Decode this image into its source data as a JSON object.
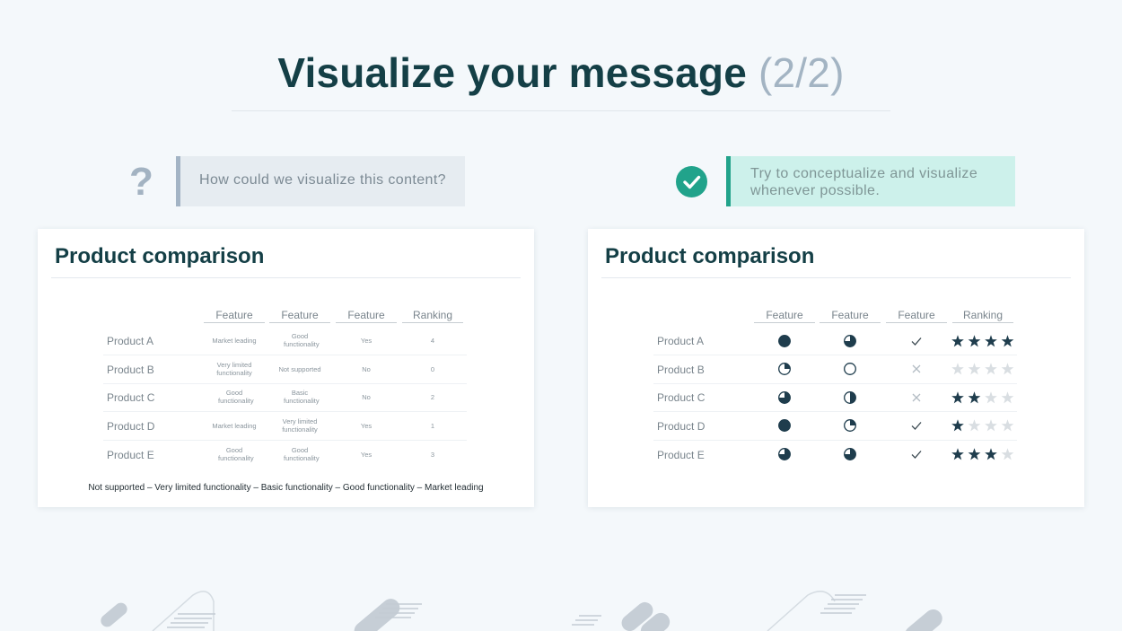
{
  "title": {
    "main": "Visualize your message",
    "accent": "(2/2)"
  },
  "left_prompt": {
    "mark": "?",
    "text": "How could  we visualize this content?"
  },
  "right_prompt": {
    "text_line1": "Try to conceptualize and visualize",
    "text_line2": "whenever possible."
  },
  "colors": {
    "dark": "#143f46",
    "accent_teal": "#22a38b",
    "muted": "#a3b4c3",
    "star_on": "#1f3d4d",
    "star_off": "#d9dee2"
  },
  "left_card": {
    "title": "Product comparison",
    "headers": [
      "Feature",
      "Feature",
      "Feature",
      "Ranking"
    ],
    "rows": [
      {
        "name": "Product A",
        "c1": "Market leading",
        "c2": "Good functionality",
        "c3": "Yes",
        "c4": "4"
      },
      {
        "name": "Product B",
        "c1": "Very limited functionality",
        "c2": "Not supported",
        "c3": "No",
        "c4": "0"
      },
      {
        "name": "Product C",
        "c1": "Good functionality",
        "c2": "Basic functionality",
        "c3": "No",
        "c4": "2"
      },
      {
        "name": "Product D",
        "c1": "Market leading",
        "c2": "Very limited functionality",
        "c3": "Yes",
        "c4": "1"
      },
      {
        "name": "Product E",
        "c1": "Good functionality",
        "c2": "Good functionality",
        "c3": "Yes",
        "c4": "3"
      }
    ],
    "legend": "Not supported – Very limited functionality – Basic functionality – Good functionality – Market leading"
  },
  "right_card": {
    "title": "Product comparison",
    "headers": [
      "Feature",
      "Feature",
      "Feature",
      "Ranking"
    ],
    "rows": [
      {
        "name": "Product A",
        "f1_level": 4,
        "f2_level": 3,
        "f3": "check-icon",
        "stars": 4
      },
      {
        "name": "Product B",
        "f1_level": 1,
        "f2_level": 0,
        "f3": "cross-icon",
        "stars": 0
      },
      {
        "name": "Product C",
        "f1_level": 3,
        "f2_level": 2,
        "f3": "cross-icon",
        "stars": 2
      },
      {
        "name": "Product D",
        "f1_level": 4,
        "f2_level": 1,
        "f3": "check-icon",
        "stars": 1
      },
      {
        "name": "Product E",
        "f1_level": 3,
        "f2_level": 3,
        "f3": "check-icon",
        "stars": 3
      }
    ],
    "harvey_scale_max": 4,
    "stars_max": 4
  }
}
